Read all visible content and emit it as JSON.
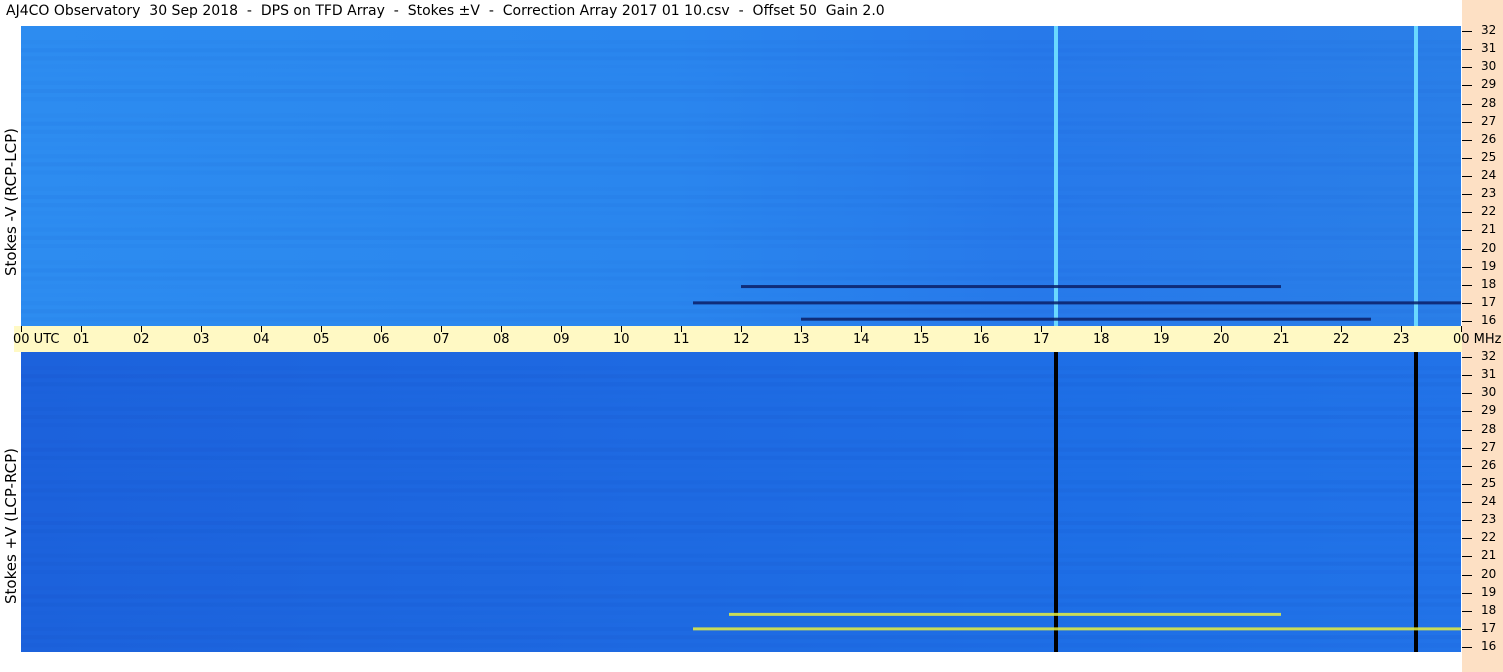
{
  "title": "AJ4CO Observatory  30 Sep 2018  -  DPS on TFD Array  -  Stokes ±V  -  Correction Array 2017 01 10.csv  -  Offset 50  Gain 2.0",
  "colors": {
    "top_panel": "#2a86ee",
    "bottom_panel": "#1e6ae2",
    "time_bar": "#fff9c4",
    "right_bar": "#fde0c4",
    "interference": "#000000"
  },
  "chart_data": [
    {
      "type": "heatmap",
      "panel": "top",
      "ylabel": "Stokes -V (RCP-LCP)",
      "y_unit": "MHz",
      "ylim": [
        16,
        32
      ],
      "yticks": [
        "16",
        "17",
        "18",
        "19",
        "20",
        "21",
        "22",
        "23",
        "24",
        "25",
        "26",
        "27",
        "28",
        "29",
        "30",
        "31",
        "32"
      ],
      "x_unit": "UTC",
      "xlim_hours": [
        0,
        24
      ],
      "features": [
        {
          "kind": "vertical-line",
          "time_utc": 17.25,
          "color": "#6ad8ff"
        },
        {
          "kind": "vertical-line",
          "time_utc": 23.25,
          "color": "#6ad8ff"
        },
        {
          "kind": "dark-band",
          "freq_mhz": 17.0,
          "from_utc": 11.2,
          "to_utc": 24.0
        },
        {
          "kind": "dark-band",
          "freq_mhz": 17.9,
          "from_utc": 12.0,
          "to_utc": 21.0
        },
        {
          "kind": "dark-band",
          "freq_mhz": 16.1,
          "from_utc": 13.0,
          "to_utc": 22.5
        }
      ]
    },
    {
      "type": "heatmap",
      "panel": "bottom",
      "ylabel": "Stokes +V (LCP-RCP)",
      "y_unit": "MHz",
      "ylim": [
        16,
        32
      ],
      "yticks": [
        "16",
        "17",
        "18",
        "19",
        "20",
        "21",
        "22",
        "23",
        "24",
        "25",
        "26",
        "27",
        "28",
        "29",
        "30",
        "31",
        "32"
      ],
      "x_unit": "UTC",
      "xlim_hours": [
        0,
        24
      ],
      "features": [
        {
          "kind": "vertical-line",
          "time_utc": 17.25,
          "color": "#000000"
        },
        {
          "kind": "vertical-line",
          "time_utc": 23.25,
          "color": "#000000"
        },
        {
          "kind": "bright-band",
          "freq_mhz": 17.8,
          "from_utc": 11.8,
          "to_utc": 21.0
        },
        {
          "kind": "bright-band",
          "freq_mhz": 17.0,
          "from_utc": 11.2,
          "to_utc": 24.0
        }
      ]
    }
  ],
  "time_axis": {
    "labels": [
      "00",
      "01",
      "02",
      "03",
      "04",
      "05",
      "06",
      "07",
      "08",
      "09",
      "10",
      "11",
      "12",
      "13",
      "14",
      "15",
      "16",
      "17",
      "18",
      "19",
      "20",
      "21",
      "22",
      "23",
      "00"
    ],
    "start_unit": "UTC",
    "end_unit": "MHz"
  }
}
